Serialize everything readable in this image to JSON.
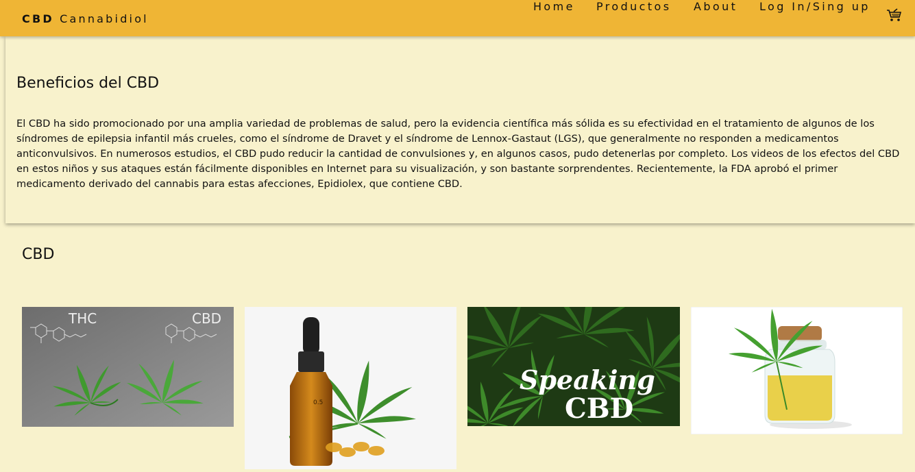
{
  "navbar": {
    "brand_bold": "CBD",
    "brand_rest": "Cannabidiol",
    "links": [
      "Home",
      "Productos",
      "About",
      "Log In/Sing up"
    ],
    "cart_icon": "cart-icon"
  },
  "benefits": {
    "title": "Beneficios del CBD",
    "body": "El CBD ha sido promocionado por una amplia variedad de problemas de salud, pero la evidencia científica más sólida es su efectividad en el tratamiento de algunos de los síndromes de epilepsia infantil más crueles, como el síndrome de Dravet y el síndrome de Lennox-Gastaut (LGS), que generalmente no responden a medicamentos anticonvulsivos. En numerosos estudios, el CBD pudo reducir la cantidad de convulsiones y, en algunos casos, pudo detenerlas por completo. Los videos de los efectos del CBD en estos niños y sus ataques están fácilmente disponibles en Internet para su visualización, y son bastante sorprendentes. Recientemente, la FDA aprobó el primer medicamento derivado del cannabis para estas afecciones, Epidiolex, que contiene CBD."
  },
  "gallery": {
    "title": "CBD",
    "images": [
      {
        "labels": [
          "THC",
          "CBD"
        ]
      },
      {
        "bottle_mark": "0.5"
      },
      {
        "line1": "Speaking",
        "line2": "CBD"
      },
      {}
    ]
  },
  "colors": {
    "navbar": "#efb535",
    "background": "#f8f2cc",
    "leaf": "#3f9a2e"
  }
}
